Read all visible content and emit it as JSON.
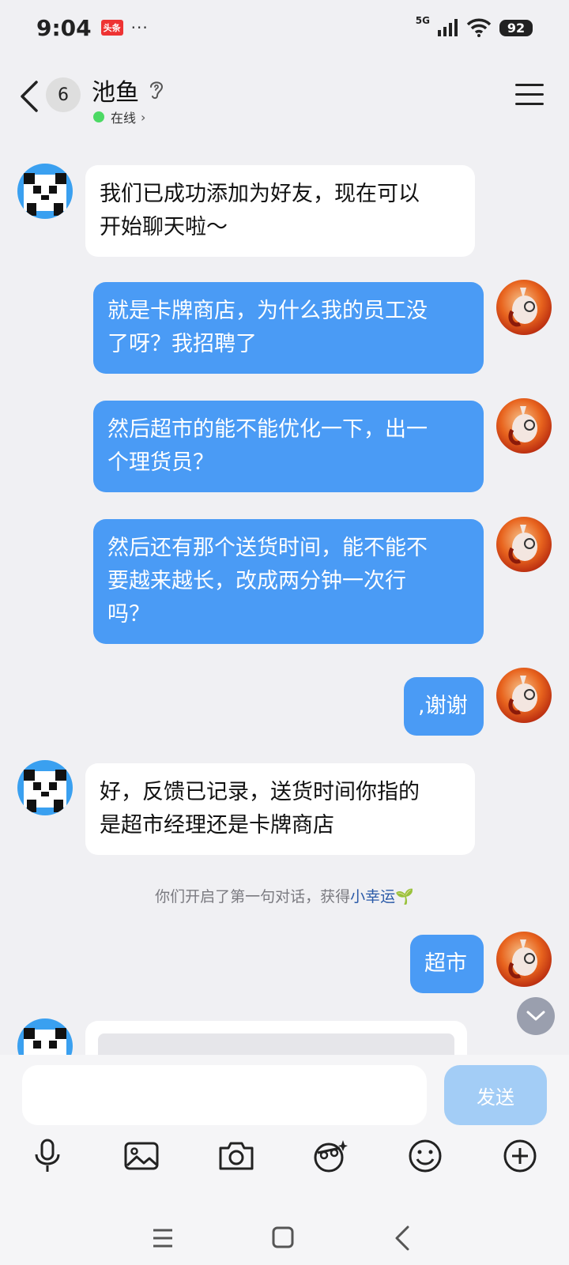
{
  "status_bar": {
    "time": "9:04",
    "news_badge": "头条",
    "more": "···",
    "network": "5G",
    "battery": "92"
  },
  "header": {
    "unread_count": "6",
    "contact_name": "池鱼",
    "online": "在线",
    "chevron": "›"
  },
  "chat": {
    "messages": [
      {
        "side": "in",
        "text_line1": "我们已成功添加为好友，现在可以",
        "text_line2": "开始聊天啦～"
      },
      {
        "side": "out",
        "text_line1": "就是卡牌商店，为什么我的员工没",
        "text_line2": "了呀？我招聘了"
      },
      {
        "side": "out",
        "text_line1": "然后超市的能不能优化一下，出一",
        "text_line2": "个理货员？"
      },
      {
        "side": "out",
        "text_line1": "然后还有那个送货时间，能不能不",
        "text_line2": "要越来越长，改成两分钟一次行",
        "text_line3": "吗？"
      },
      {
        "side": "out",
        "text": ",谢谢"
      },
      {
        "side": "in",
        "text_line1": "好，反馈已记录，送货时间你指的",
        "text_line2": "是超市经理还是卡牌商店"
      },
      {
        "side": "out",
        "text": "超市"
      }
    ],
    "system_note": {
      "prefix": "你们开启了第一句对话，获得",
      "link": "小幸运",
      "emoji": "🌱"
    }
  },
  "input": {
    "placeholder": "",
    "send_label": "发送"
  },
  "icons": [
    "microphone-icon",
    "image-icon",
    "camera-icon",
    "sticker-icon",
    "emoji-icon",
    "plus-icon"
  ],
  "colors": {
    "out_bubble": "#4a9bf5",
    "send_button_disabled": "#a3cdf6",
    "online": "#4cd964"
  }
}
